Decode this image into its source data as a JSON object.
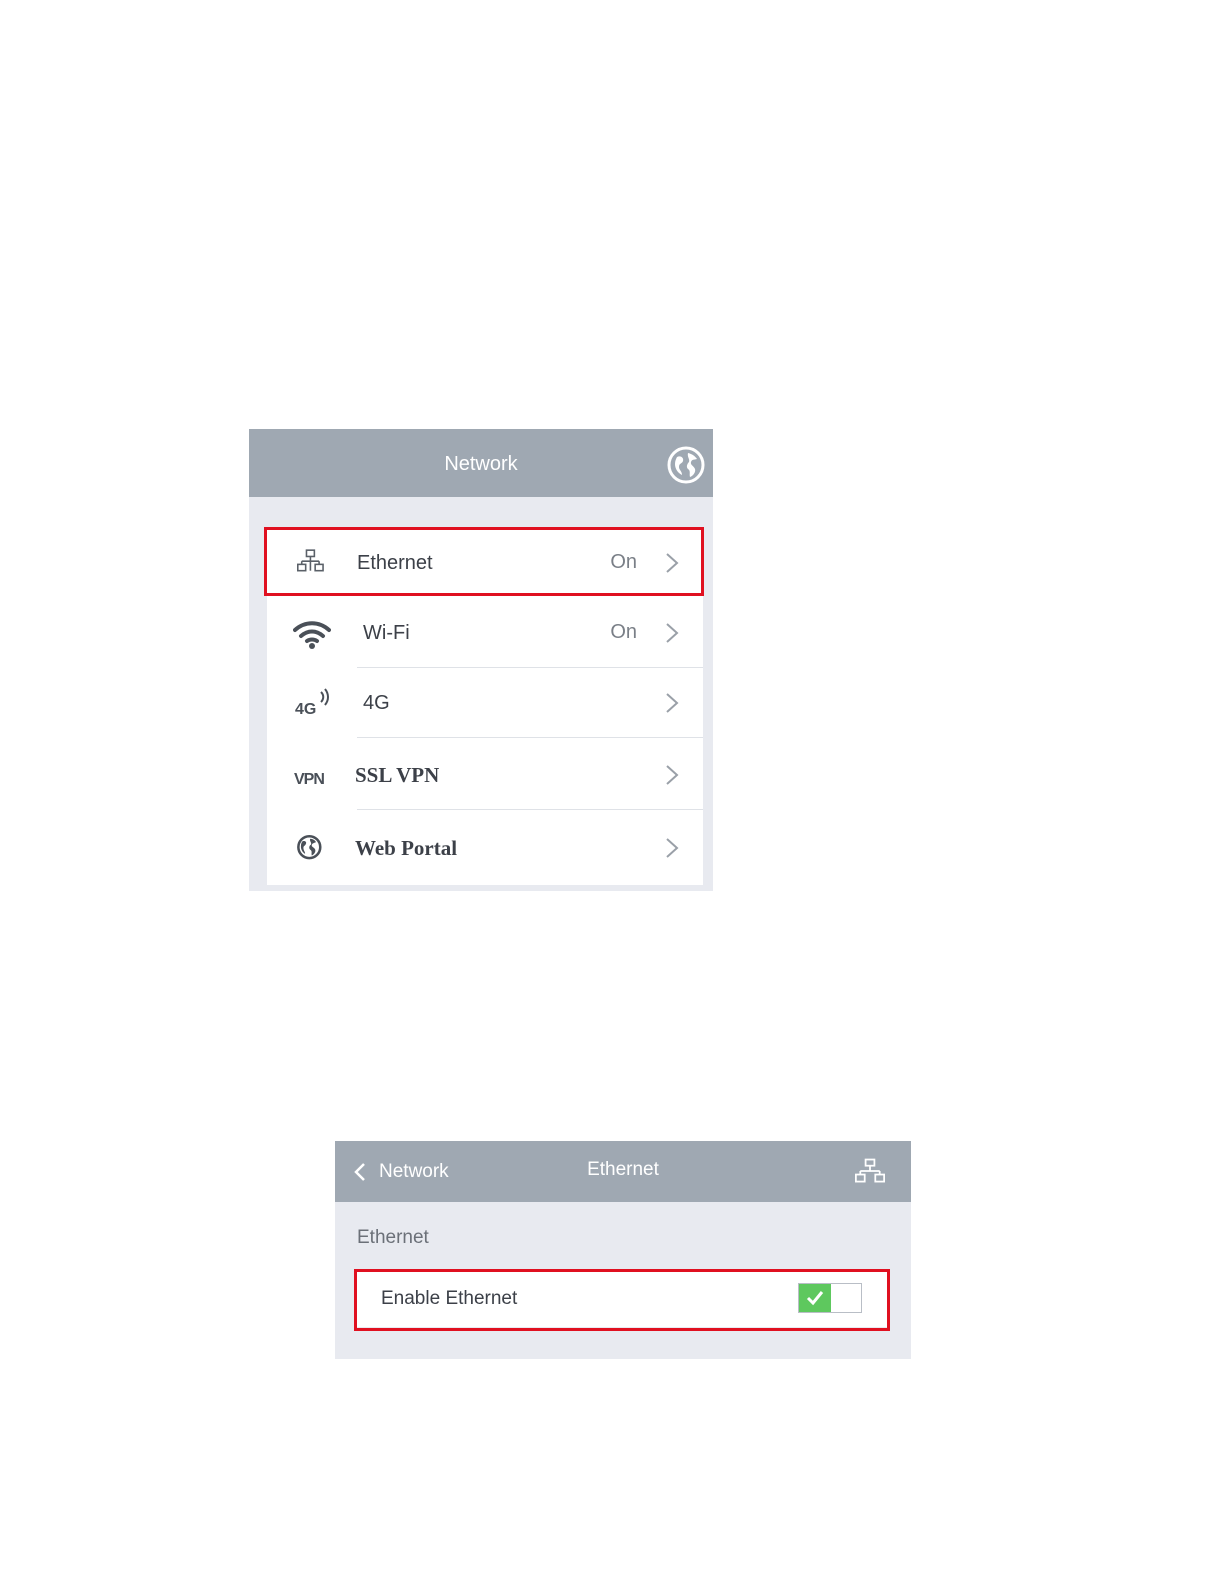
{
  "network_panel": {
    "title": "Network",
    "header_icon": "globe-icon",
    "items": [
      {
        "icon": "ethernet-icon",
        "label": "Ethernet",
        "status": "On"
      },
      {
        "icon": "wifi-icon",
        "label": "Wi-Fi",
        "status": "On"
      },
      {
        "icon": "4g-icon",
        "icon_text": "4G",
        "label": "4G",
        "status": ""
      },
      {
        "icon": "vpn-icon",
        "icon_text": "VPN",
        "label": "SSL VPN",
        "status": ""
      },
      {
        "icon": "globe-icon",
        "label": "Web Portal",
        "status": ""
      }
    ]
  },
  "ethernet_panel": {
    "back_label": "Network",
    "title": "Ethernet",
    "header_icon": "ethernet-icon",
    "section_label": "Ethernet",
    "setting": {
      "label": "Enable Ethernet",
      "enabled": true
    }
  },
  "colors": {
    "header_bg": "#9fa8b2",
    "panel_bg": "#e8eaf0",
    "highlight": "#e01020",
    "toggle_on": "#5ec85e"
  }
}
